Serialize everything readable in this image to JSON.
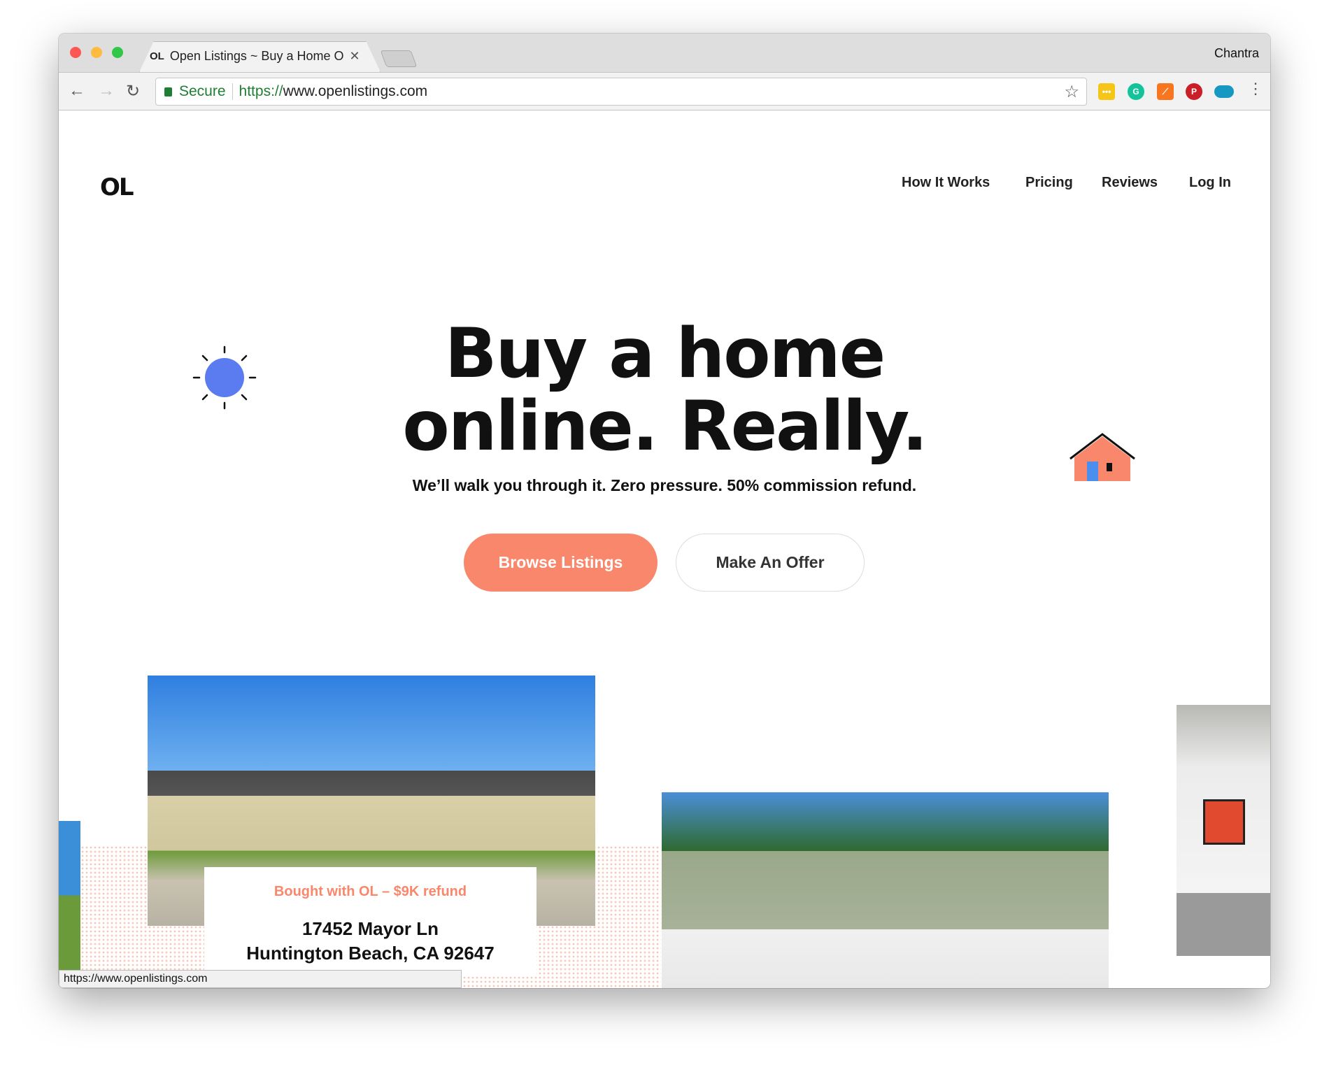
{
  "browser": {
    "tab_title": "Open Listings ~ Buy a Home O",
    "tab_favicon": "OL",
    "user": "Chantra",
    "secure_label": "Secure",
    "url_scheme": "https://",
    "url_host": "www.openlistings.com",
    "extensions": [
      "lastpass-icon",
      "grammarly-icon",
      "analytics-icon",
      "pinterest-icon",
      "salesforce-icon"
    ],
    "status_url": "https://www.openlistings.com"
  },
  "site": {
    "logo": "OL",
    "nav": [
      "How It Works",
      "Pricing",
      "Reviews",
      "Log In"
    ],
    "headline_line1": "Buy a home",
    "headline_line2": "online. Really.",
    "subheadline": "We’ll walk you through it. Zero pressure. 50% commission refund.",
    "primary_button": "Browse Listings",
    "secondary_button": "Make An Offer",
    "accent_color": "#f8876b",
    "sun_color": "#5b7cf0"
  },
  "featured": {
    "badge": "Bought with OL – $9K refund",
    "address_line1": "17452 Mayor Ln",
    "address_line2": "Huntington Beach, CA 92647"
  }
}
